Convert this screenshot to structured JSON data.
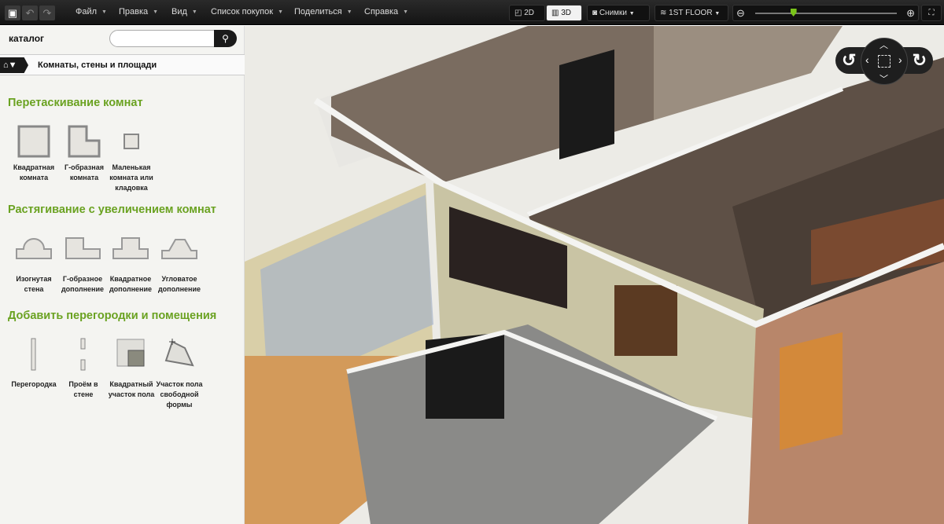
{
  "toolbar": {
    "menus": [
      "Файл",
      "Правка",
      "Вид",
      "Список покупок",
      "Поделиться",
      "Справка"
    ],
    "view_2d": "2D",
    "view_3d": "3D",
    "active_view": "3D",
    "snapshots": "Снимки",
    "floor": "1ST FLOOR",
    "zoom_level": 0.27,
    "accent": "#7ac41a"
  },
  "sidebar": {
    "catalog_label": "каталог",
    "search": {
      "value": "",
      "placeholder": ""
    },
    "breadcrumb": "Комнаты, стены и площади",
    "sections": [
      {
        "title": "Перетаскивание комнат",
        "items": [
          "Квадратная комната",
          "Г-образная комната",
          "Маленькая комната или кладовка"
        ]
      },
      {
        "title": "Растягивание с увеличением комнат",
        "items": [
          "Изогнутая стена",
          "Г-образное дополнение",
          "Квадратное дополнение",
          "Угловатое дополнение"
        ]
      },
      {
        "title": "Добавить перегородки и помещения",
        "items": [
          "Перегородка",
          "Проём в стене",
          "Квадратный участок пола",
          "Участок пола свободной формы"
        ]
      }
    ],
    "heading_color": "#6aa221"
  }
}
